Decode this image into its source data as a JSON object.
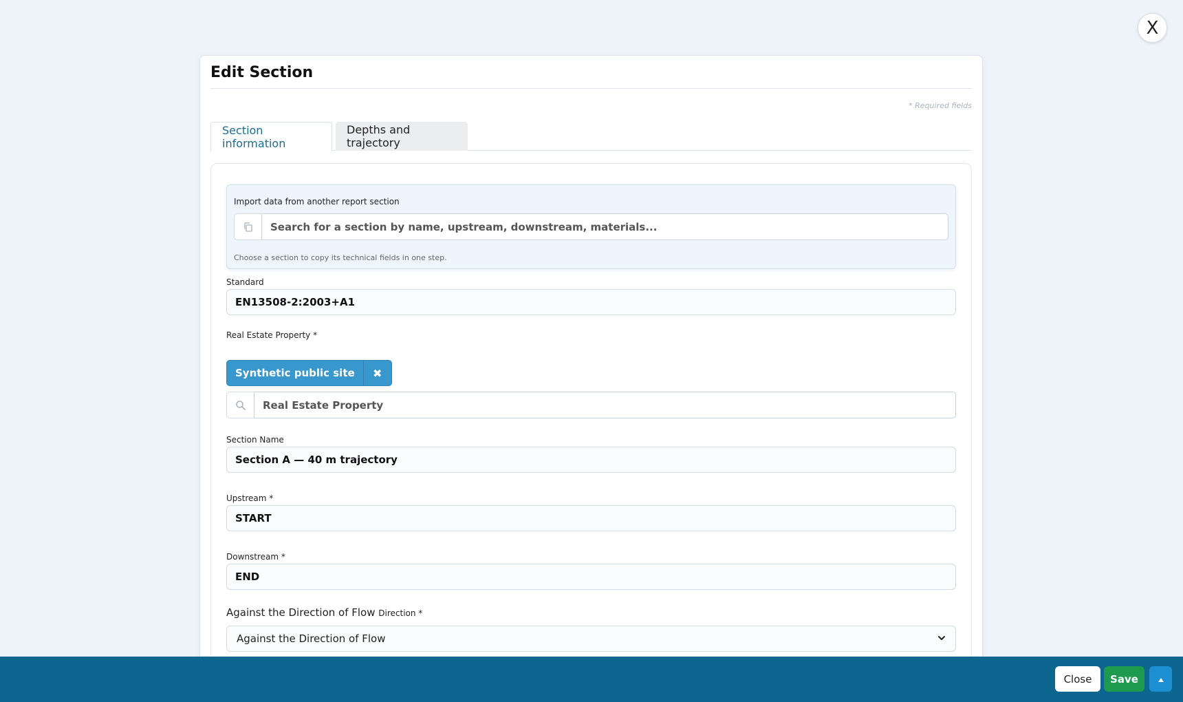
{
  "close_x": {
    "label": "X"
  },
  "modal": {
    "title": "Edit Section",
    "required_note": "* Required fields"
  },
  "tabs": [
    {
      "label": "Section information",
      "active": true
    },
    {
      "label": "Depths and trajectory",
      "active": false
    }
  ],
  "import": {
    "label": "Import data from another report section",
    "placeholder": "Search for a section by name, upstream, downstream, materials...",
    "help": "Choose a section to copy its technical fields in one step.",
    "icon": "copy-icon"
  },
  "fields": {
    "standard": {
      "label": "Standard",
      "value": "EN13508-2:2003+A1"
    },
    "property": {
      "label": "Real Estate Property *",
      "selected": "Synthetic public site",
      "remove_icon": "times-icon",
      "search_icon": "search-icon",
      "placeholder": "Real Estate Property"
    },
    "section_name": {
      "label": "Section Name",
      "value": "Section A — 40 m trajectory"
    },
    "upstream": {
      "label": "Upstream *",
      "value": "START"
    },
    "downstream": {
      "label": "Downstream *",
      "value": "END"
    },
    "direction": {
      "label": "Against the Direction of Flow",
      "label_small": "Direction *",
      "selected": "Against the Direction of Flow"
    }
  },
  "footer": {
    "close_label": "Close",
    "save_label": "Save",
    "up_icon": "caret-up-icon"
  },
  "colors": {
    "footer": "#0c6690",
    "save": "#1e9a4e",
    "chip": "#3897cc",
    "accent_tab": "#1b6d8f"
  }
}
